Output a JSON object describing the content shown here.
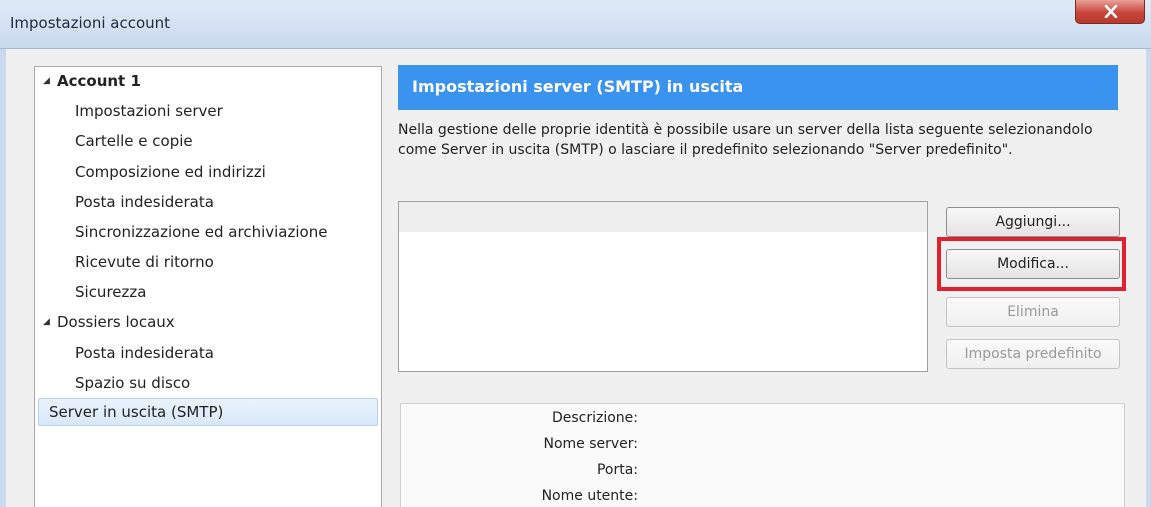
{
  "window": {
    "title": "Impostazioni account"
  },
  "tree": {
    "items": [
      {
        "label": "Account 1",
        "level": 0,
        "expanded": true,
        "bold": true
      },
      {
        "label": "Impostazioni server",
        "level": 1
      },
      {
        "label": "Cartelle e copie",
        "level": 1
      },
      {
        "label": "Composizione ed indirizzi",
        "level": 1
      },
      {
        "label": "Posta indesiderata",
        "level": 1
      },
      {
        "label": "Sincronizzazione ed archiviazione",
        "level": 1
      },
      {
        "label": "Ricevute di ritorno",
        "level": 1
      },
      {
        "label": "Sicurezza",
        "level": 1
      },
      {
        "label": "Dossiers locaux",
        "level": 0,
        "expanded": true
      },
      {
        "label": "Posta indesiderata",
        "level": 1
      },
      {
        "label": "Spazio su disco",
        "level": 1
      },
      {
        "label": "Server in uscita (SMTP)",
        "level": 0,
        "selected": true
      }
    ]
  },
  "panel": {
    "header": "Impostazioni server (SMTP) in uscita",
    "description": "Nella gestione delle proprie identità è possibile usare un server della lista seguente selezionandolo come Server in uscita (SMTP) o lasciare il predefinito selezionando \"Server predefinito\"."
  },
  "buttons": {
    "add": "Aggiungi...",
    "edit": "Modifica...",
    "delete": "Elimina",
    "set_default": "Imposta predefinito"
  },
  "details": {
    "description_label": "Descrizione:",
    "server_label": "Nome server:",
    "port_label": "Porta:",
    "user_label": "Nome utente:"
  },
  "colors": {
    "header_bg": "#3b93f0",
    "highlight": "#e0202e"
  }
}
